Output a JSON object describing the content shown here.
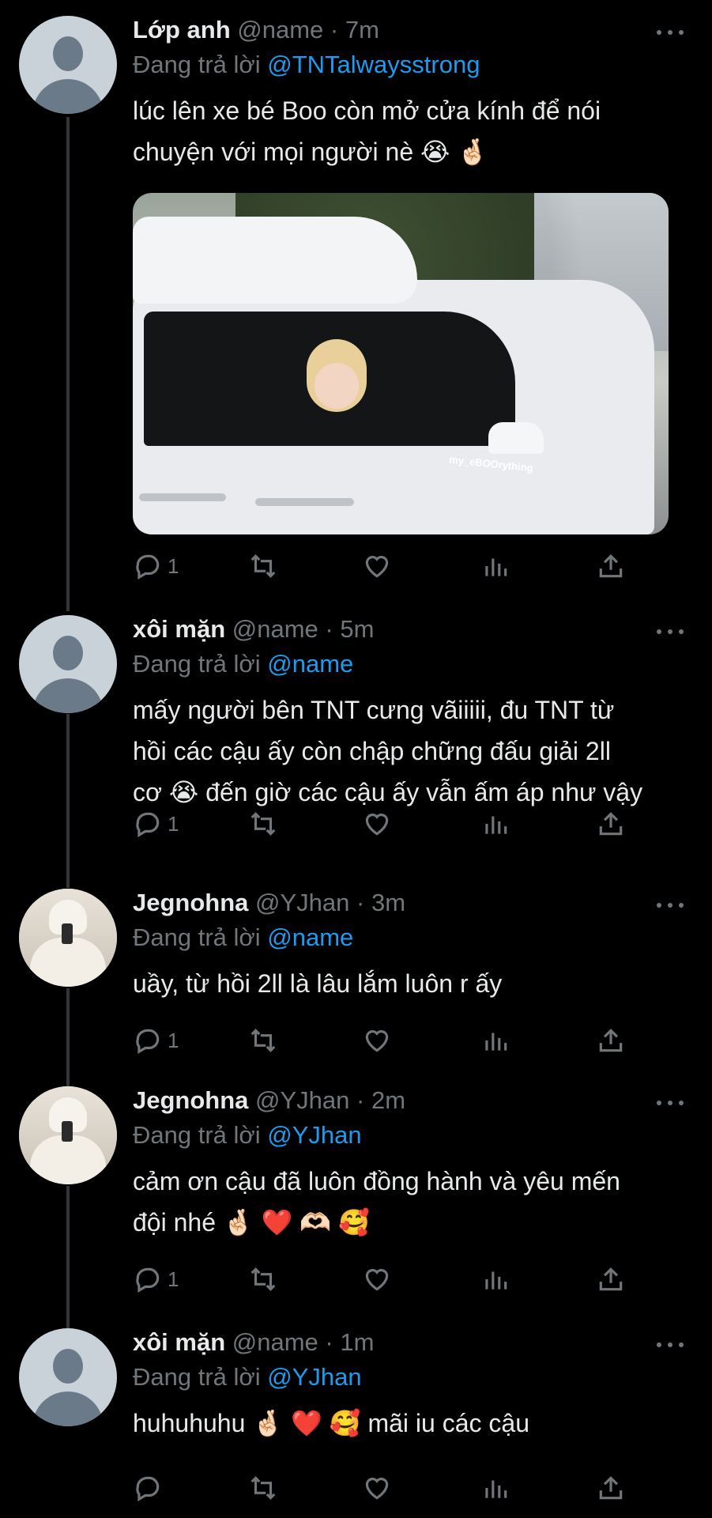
{
  "tweets": [
    {
      "name": "Lớp anh",
      "handle": "@name",
      "time": "7m",
      "replying_prefix": "Đang trả lời",
      "replying_to": "@TNTalwaysstrong",
      "text_lines": [
        "lúc lên xe bé Boo còn mở cửa kính để nói",
        "chuyện với mọi người nè 😭 🤞🏻"
      ],
      "media_watermark": "my_eBOOrything",
      "reply_count": "1",
      "avatar": "default"
    },
    {
      "name": "xôi mặn",
      "handle": "@name",
      "time": "5m",
      "replying_prefix": "Đang trả lời",
      "replying_to": "@name",
      "text_lines": [
        "mấy người bên TNT cưng vãiiiii, đu TNT từ",
        "hồi các cậu ấy còn chập chững đấu giải 2ll",
        "cơ 😭 đến giờ các cậu ấy vẫn ấm áp như vậy"
      ],
      "reply_count": "1",
      "avatar": "default"
    },
    {
      "name": "Jegnohna",
      "handle": "@YJhan",
      "time": "3m",
      "replying_prefix": "Đang trả lời",
      "replying_to": "@name",
      "text_lines": [
        "uầy, từ hồi 2ll là lâu lắm luôn r ấy"
      ],
      "reply_count": "1",
      "avatar": "photo"
    },
    {
      "name": "Jegnohna",
      "handle": "@YJhan",
      "time": "2m",
      "replying_prefix": "Đang trả lời",
      "replying_to": "@YJhan",
      "text_lines": [
        "cảm ơn cậu đã luôn đồng hành và yêu mến",
        "đội nhé 🤞🏻 ❤️ 🫶🏻 🥰"
      ],
      "reply_count": "1",
      "avatar": "photo"
    },
    {
      "name": "xôi mặn",
      "handle": "@name",
      "time": "1m",
      "replying_prefix": "Đang trả lời",
      "replying_to": "@YJhan",
      "text_lines": [
        "huhuhuhu 🤞🏻 ❤️ 🥰  mãi iu các cậu"
      ],
      "reply_count": "",
      "avatar": "default"
    }
  ],
  "separator": "·",
  "icons": [
    "reply-icon",
    "retweet-icon",
    "like-icon",
    "analytics-icon",
    "share-icon",
    "more-icon"
  ],
  "colors": {
    "background": "#000000",
    "text": "#e7e9ea",
    "muted": "#71767b",
    "link": "#1d9bf0"
  }
}
